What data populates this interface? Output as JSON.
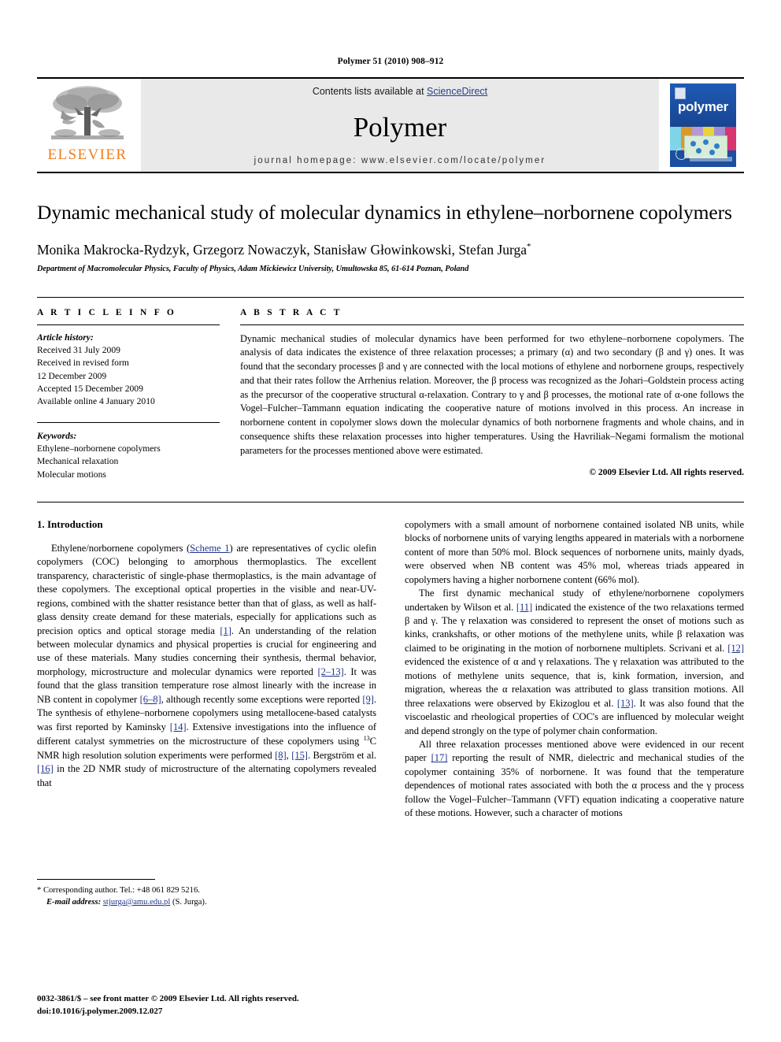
{
  "running_head": "Polymer 51 (2010) 908–912",
  "masthead": {
    "publisher_name": "ELSEVIER",
    "contents_prefix": "Contents lists available at ",
    "sciencedirect_link": "ScienceDirect",
    "journal_title": "Polymer",
    "homepage_line": "journal homepage: www.elsevier.com/locate/polymer",
    "cover_word": "polymer",
    "link_color": "#2b3d8f"
  },
  "article": {
    "title": "Dynamic mechanical study of molecular dynamics in ethylene–norbornene copolymers",
    "authors": "Monika Makrocka-Rydzyk, Grzegorz Nowaczyk, Stanisław Głowinkowski, Stefan Jurga",
    "author_corresponding_mark": "*",
    "affiliation": "Department of Macromolecular Physics, Faculty of Physics, Adam Mickiewicz University, Umultowska 85, 61-614 Poznan, Poland"
  },
  "article_info": {
    "heading": "A R T I C L E   I N F O",
    "history_label": "Article history:",
    "history": [
      "Received 31 July 2009",
      "Received in revised form",
      "12 December 2009",
      "Accepted 15 December 2009",
      "Available online 4 January 2010"
    ],
    "keywords_label": "Keywords:",
    "keywords": [
      "Ethylene–norbornene copolymers",
      "Mechanical relaxation",
      "Molecular motions"
    ]
  },
  "abstract": {
    "heading": "A B S T R A C T",
    "text": "Dynamic mechanical studies of molecular dynamics have been performed for two ethylene–norbornene copolymers. The analysis of data indicates the existence of three relaxation processes; a primary (α) and two secondary (β and γ) ones. It was found that the secondary processes β and γ are connected with the local motions of ethylene and norbornene groups, respectively and that their rates follow the Arrhenius relation. Moreover, the β process was recognized as the Johari–Goldstein process acting as the precursor of the cooperative structural α-relaxation. Contrary to γ and β processes, the motional rate of α-one follows the Vogel–Fulcher–Tammann equation indicating the cooperative nature of motions involved in this process. An increase in norbornene content in copolymer slows down the molecular dynamics of both norbornene fragments and whole chains, and in consequence shifts these relaxation processes into higher temperatures. Using the Havriliak–Negami formalism the motional parameters for the processes mentioned above were estimated.",
    "copyright": "© 2009 Elsevier Ltd. All rights reserved."
  },
  "body": {
    "section_heading": "1. Introduction",
    "left_paragraphs": [
      {
        "segments": [
          {
            "t": "Ethylene/norbornene copolymers ("
          },
          {
            "t": "Scheme 1",
            "link": true
          },
          {
            "t": ") are representatives of cyclic olefin copolymers (COC) belonging to amorphous thermoplastics. The excellent transparency, characteristic of single-phase thermoplastics, is the main advantage of these copolymers. The exceptional optical properties in the visible and near-UV-regions, combined with the shatter resistance better than that of glass, as well as half-glass density create demand for these materials, especially for applications such as precision optics and optical storage media "
          },
          {
            "t": "[1]",
            "link": true
          },
          {
            "t": ". An understanding of the relation between molecular dynamics and physical properties is crucial for engineering and use of these materials. Many studies concerning their synthesis, thermal behavior, morphology, microstructure and molecular dynamics were reported "
          },
          {
            "t": "[2–13]",
            "link": true
          },
          {
            "t": ". It was found that the glass transition temperature rose almost linearly with the increase in NB content in copolymer "
          },
          {
            "t": "[6–8]",
            "link": true
          },
          {
            "t": ", although recently some exceptions were reported "
          },
          {
            "t": "[9]",
            "link": true
          },
          {
            "t": ". The synthesis of ethylene–norbornene copolymers using metallocene-based catalysts was first reported by Kaminsky "
          },
          {
            "t": "[14]",
            "link": true
          },
          {
            "t": ". Extensive investigations into the influence of different catalyst symmetries on the microstructure of these copolymers using "
          },
          {
            "t": "13",
            "sup": true
          },
          {
            "t": "C NMR high resolution solution experiments were performed "
          },
          {
            "t": "[8]",
            "link": true
          },
          {
            "t": ", "
          },
          {
            "t": "[15]",
            "link": true
          },
          {
            "t": ". Bergström et al. "
          },
          {
            "t": "[16]",
            "link": true
          },
          {
            "t": " in the 2D NMR study of microstructure of the alternating copolymers revealed that"
          }
        ]
      }
    ],
    "right_paragraphs": [
      {
        "indent": false,
        "segments": [
          {
            "t": "copolymers with a small amount of norbornene contained isolated NB units, while blocks of norbornene units of varying lengths appeared in materials with a norbornene content of more than 50% mol. Block sequences of norbornene units, mainly dyads, were observed when NB content was 45% mol, whereas triads appeared in copolymers having a higher norbornene content (66% mol)."
          }
        ]
      },
      {
        "indent": true,
        "segments": [
          {
            "t": "The first dynamic mechanical study of ethylene/norbornene copolymers undertaken by Wilson et al. "
          },
          {
            "t": "[11]",
            "link": true
          },
          {
            "t": " indicated the existence of the two relaxations termed β and γ. The γ relaxation was considered to represent the onset of motions such as kinks, crankshafts, or other motions of the methylene units, while β relaxation was claimed to be originating in the motion of norbornene multiplets. Scrivani et al. "
          },
          {
            "t": "[12]",
            "link": true
          },
          {
            "t": " evidenced the existence of α and γ relaxations. The γ relaxation was attributed to the motions of methylene units sequence, that is, kink formation, inversion, and migration, whereas the α relaxation was attributed to glass transition motions. All three relaxations were observed by Ekizoglou et al. "
          },
          {
            "t": "[13]",
            "link": true
          },
          {
            "t": ". It was also found that the viscoelastic and rheological properties of COC's are influenced by molecular weight and depend strongly on the type of polymer chain conformation."
          }
        ]
      },
      {
        "indent": true,
        "segments": [
          {
            "t": "All three relaxation processes mentioned above were evidenced in our recent paper "
          },
          {
            "t": "[17]",
            "link": true
          },
          {
            "t": " reporting the result of NMR, dielectric and mechanical studies of the copolymer containing 35% of norbornene. It was found that the temperature dependences of motional rates associated with both the α process and the γ process follow the Vogel–Fulcher–Tammann (VFT) equation indicating a cooperative nature of these motions. However, such a character of motions"
          }
        ]
      }
    ]
  },
  "footnote": {
    "corresponding": "* Corresponding author. Tel.: +48 061 829 5216.",
    "email_label": "E-mail address:",
    "email": "stjurga@amu.edu.pl",
    "email_suffix": "(S. Jurga)."
  },
  "imprint": {
    "line1": "0032-3861/$ – see front matter © 2009 Elsevier Ltd. All rights reserved.",
    "line2": "doi:10.1016/j.polymer.2009.12.027"
  }
}
